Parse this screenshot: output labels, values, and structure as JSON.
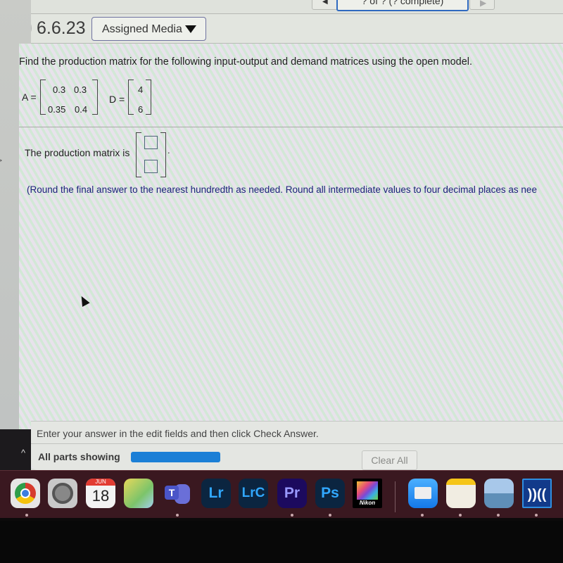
{
  "nav": {
    "page_indicator": "? of ? (? complete)",
    "prev_icon": "triangle-left-icon",
    "next_icon": "triangle-right-icon"
  },
  "question": {
    "status_icon": "x-mark-icon",
    "status": "incorrect",
    "number": "6.6.23",
    "media_button": "Assigned Media",
    "prompt": "Find the production matrix for the following input-output and demand matrices using the open model.",
    "matrix_a": {
      "label": "A =",
      "rows": [
        [
          "0.3",
          "0.3"
        ],
        [
          "0.35",
          "0.4"
        ]
      ]
    },
    "matrix_d": {
      "label": "D =",
      "rows": [
        [
          "4"
        ],
        [
          "6"
        ]
      ]
    },
    "answer_label": "The production matrix is",
    "answer_fields": [
      "",
      ""
    ],
    "answer_suffix": ".",
    "hint": "(Round the final answer to the nearest hundredth as needed. Round all intermediate values to four decimal places as nee"
  },
  "footer": {
    "instruction": "Enter your answer in the edit fields and then click Check Answer.",
    "parts_label": "All parts showing",
    "parts_progress": 1.0,
    "clear_button": "Clear All",
    "collapse_icon": "chevron-up-icon"
  },
  "colors": {
    "progress": "#1b7fd6",
    "incorrect": "#d9343a",
    "hint_text": "#1c237a",
    "page_select_border": "#2f6ac0"
  },
  "dock": {
    "apps": [
      {
        "name": "Google Chrome",
        "icon": "chrome-icon",
        "running": true
      },
      {
        "name": "System Settings",
        "icon": "settings-icon",
        "running": false
      },
      {
        "name": "Calendar",
        "icon": "calendar-icon",
        "month": "JUN",
        "day": "18",
        "running": false
      },
      {
        "name": "Maps",
        "icon": "maps-icon",
        "running": false
      },
      {
        "name": "Microsoft Teams",
        "icon": "teams-icon",
        "label": "T",
        "running": true
      },
      {
        "name": "Lightroom",
        "icon": "lightroom-icon",
        "label": "Lr",
        "running": false
      },
      {
        "name": "Lightroom Classic",
        "icon": "lightroom-classic-icon",
        "label": "LrC",
        "running": false
      },
      {
        "name": "Premiere Pro",
        "icon": "premiere-icon",
        "label": "Pr",
        "running": true
      },
      {
        "name": "Photoshop",
        "icon": "photoshop-icon",
        "label": "Ps",
        "running": true
      },
      {
        "name": "Nikon",
        "icon": "nikon-icon",
        "label": "Nikon",
        "running": false
      },
      {
        "name": "Mail",
        "icon": "mail-icon",
        "running": true
      },
      {
        "name": "Notes",
        "icon": "notes-icon",
        "running": true
      },
      {
        "name": "Preview",
        "icon": "preview-icon",
        "running": true
      },
      {
        "name": "Remote Desktop",
        "icon": "remote-desktop-icon",
        "label": "))((",
        "running": true
      }
    ]
  }
}
